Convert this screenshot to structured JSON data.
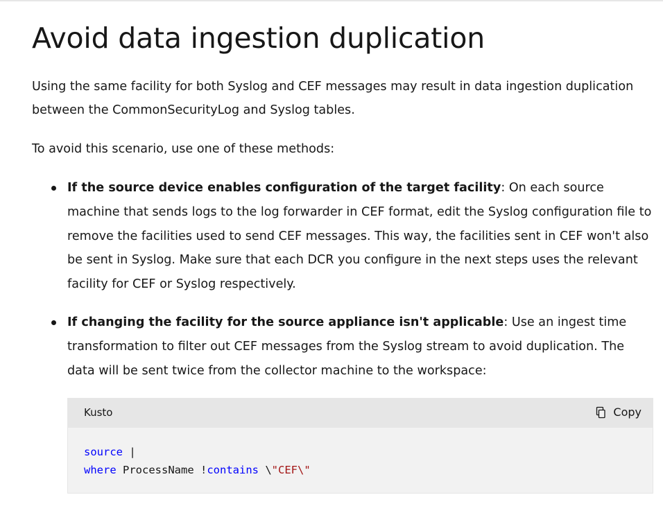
{
  "heading": "Avoid data ingestion duplication",
  "intro": "Using the same facility for both Syslog and CEF messages may result in data ingestion duplication between the CommonSecurityLog and Syslog tables.",
  "methods_intro": "To avoid this scenario, use one of these methods:",
  "methods": [
    {
      "bold": "If the source device enables configuration of the target facility",
      "text": ": On each source machine that sends logs to the log forwarder in CEF format, edit the Syslog configuration file to remove the facilities used to send CEF messages. This way, the facilities sent in CEF won't also be sent in Syslog. Make sure that each DCR you configure in the next steps uses the relevant facility for CEF or Syslog respectively."
    },
    {
      "bold": "If changing the facility for the source appliance isn't applicable",
      "text": ": Use an ingest time transformation to filter out CEF messages from the Syslog stream to avoid duplication. The data will be sent twice from the collector machine to the workspace:"
    }
  ],
  "code": {
    "language": "Kusto",
    "copy_label": "Copy",
    "copy_icon": "copy-icon",
    "line1_keyword": "source",
    "line1_rest": " |",
    "line2_keyword": "where",
    "line2_middle": " ProcessName !",
    "line2_operator": "contains",
    "line2_space": " \\",
    "line2_string": "\"CEF\\\""
  }
}
